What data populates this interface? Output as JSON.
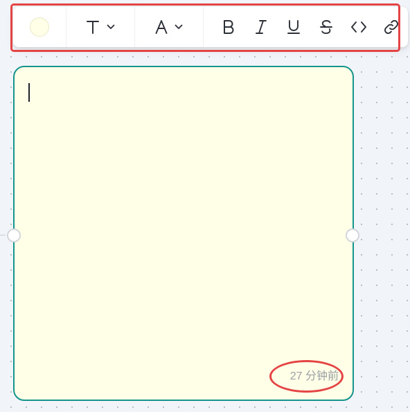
{
  "toolbar": {
    "fill_color": "#fffee6",
    "text_style_icon": "T",
    "font_color_icon": "A",
    "buttons": [
      {
        "name": "bold-button",
        "icon": "bold-icon",
        "glyph": "B"
      },
      {
        "name": "italic-button",
        "icon": "italic-icon",
        "glyph": "I"
      },
      {
        "name": "underline-button",
        "icon": "underline-icon",
        "glyph": "U"
      },
      {
        "name": "strikethrough-button",
        "icon": "strikethrough-icon",
        "glyph": "S"
      },
      {
        "name": "code-button",
        "icon": "code-icon",
        "glyph": "<>"
      },
      {
        "name": "link-button",
        "icon": "link-icon",
        "glyph": "link"
      }
    ]
  },
  "note": {
    "background": "#fffee6",
    "border_color": "#14948d",
    "text": "",
    "timestamp": "27 分钟前"
  },
  "annotations": {
    "color": "#e54444"
  }
}
